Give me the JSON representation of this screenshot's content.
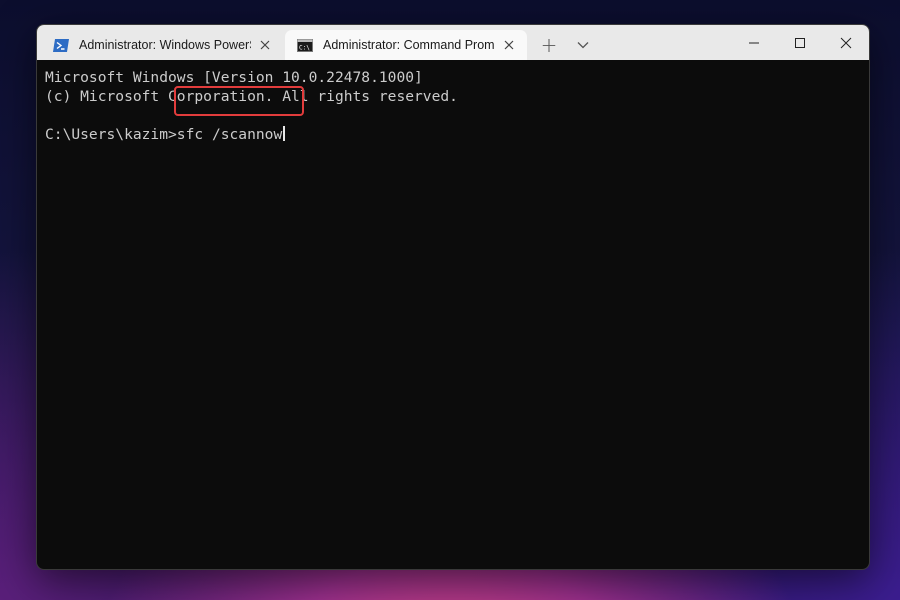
{
  "window": {
    "tabs": [
      {
        "title": "Administrator: Windows PowerShell",
        "icon": "powershell-icon",
        "active": false
      },
      {
        "title": "Administrator: Command Prompt",
        "icon": "cmd-icon",
        "active": true
      }
    ],
    "new_tab_glyph": "+",
    "controls": {
      "minimize_icon": "minimize-icon",
      "maximize_icon": "maximize-icon",
      "close_icon": "close-icon"
    }
  },
  "console": {
    "lines": [
      "Microsoft Windows [Version 10.0.22478.1000]",
      "(c) Microsoft Corporation. All rights reserved."
    ],
    "prompt": "C:\\Users\\kazim>",
    "command": "sfc /scannow"
  },
  "colors": {
    "console_bg": "#0c0c0c",
    "console_text": "#cccccc",
    "highlight": "#e23c3c",
    "titlebar_bg": "#e9e9e9",
    "active_tab_bg": "#f9f9f9"
  }
}
